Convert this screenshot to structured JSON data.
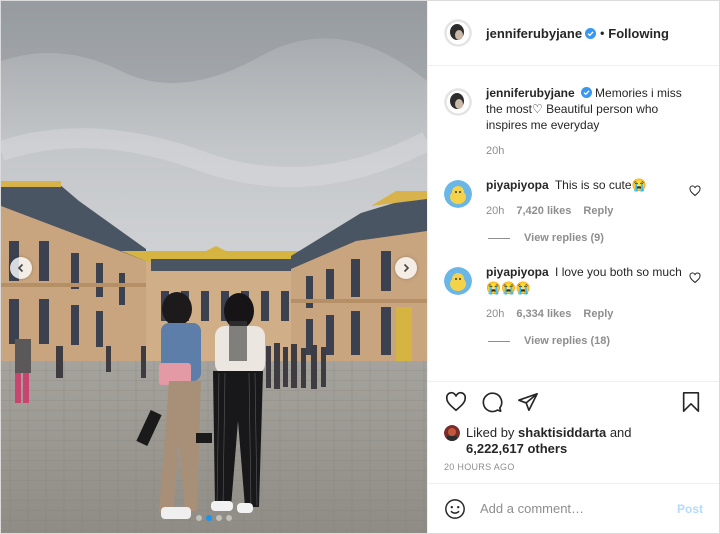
{
  "post": {
    "author": "jenniferubyjane",
    "follow_status": "Following",
    "separator": "•",
    "caption": "Memories i miss the most♡ Beautiful person who inspires me everyday",
    "caption_time": "20h",
    "carousel": {
      "total": 4,
      "active_index": 1
    }
  },
  "comments": [
    {
      "username": "piyapiyopa",
      "text": "This is so cute😭",
      "time": "20h",
      "likes": "7,420 likes",
      "reply_label": "Reply",
      "view_replies": "View replies (9)"
    },
    {
      "username": "piyapiyopa",
      "text": "I love you both so much😭😭😭",
      "time": "20h",
      "likes": "6,334 likes",
      "reply_label": "Reply",
      "view_replies": "View replies (18)"
    }
  ],
  "likes_bar": {
    "liked_by_prefix": "Liked by",
    "liked_by_user": "shaktisiddarta",
    "and_word": "and",
    "others_count": "6,222,617 others",
    "timestamp": "20 HOURS AGO"
  },
  "add_comment": {
    "placeholder": "Add a comment…",
    "post_label": "Post"
  },
  "colors": {
    "verified": "#3897f0",
    "post_button_disabled": "#b3dbff",
    "carousel_dot_active": "#1a94f0",
    "text_primary": "#262626",
    "text_secondary": "#8e8e8e"
  },
  "icons": [
    "chevron-left-icon",
    "chevron-right-icon",
    "verified-badge-icon",
    "heart-outline-icon",
    "comment-icon",
    "share-icon",
    "bookmark-icon",
    "emoji-icon"
  ]
}
